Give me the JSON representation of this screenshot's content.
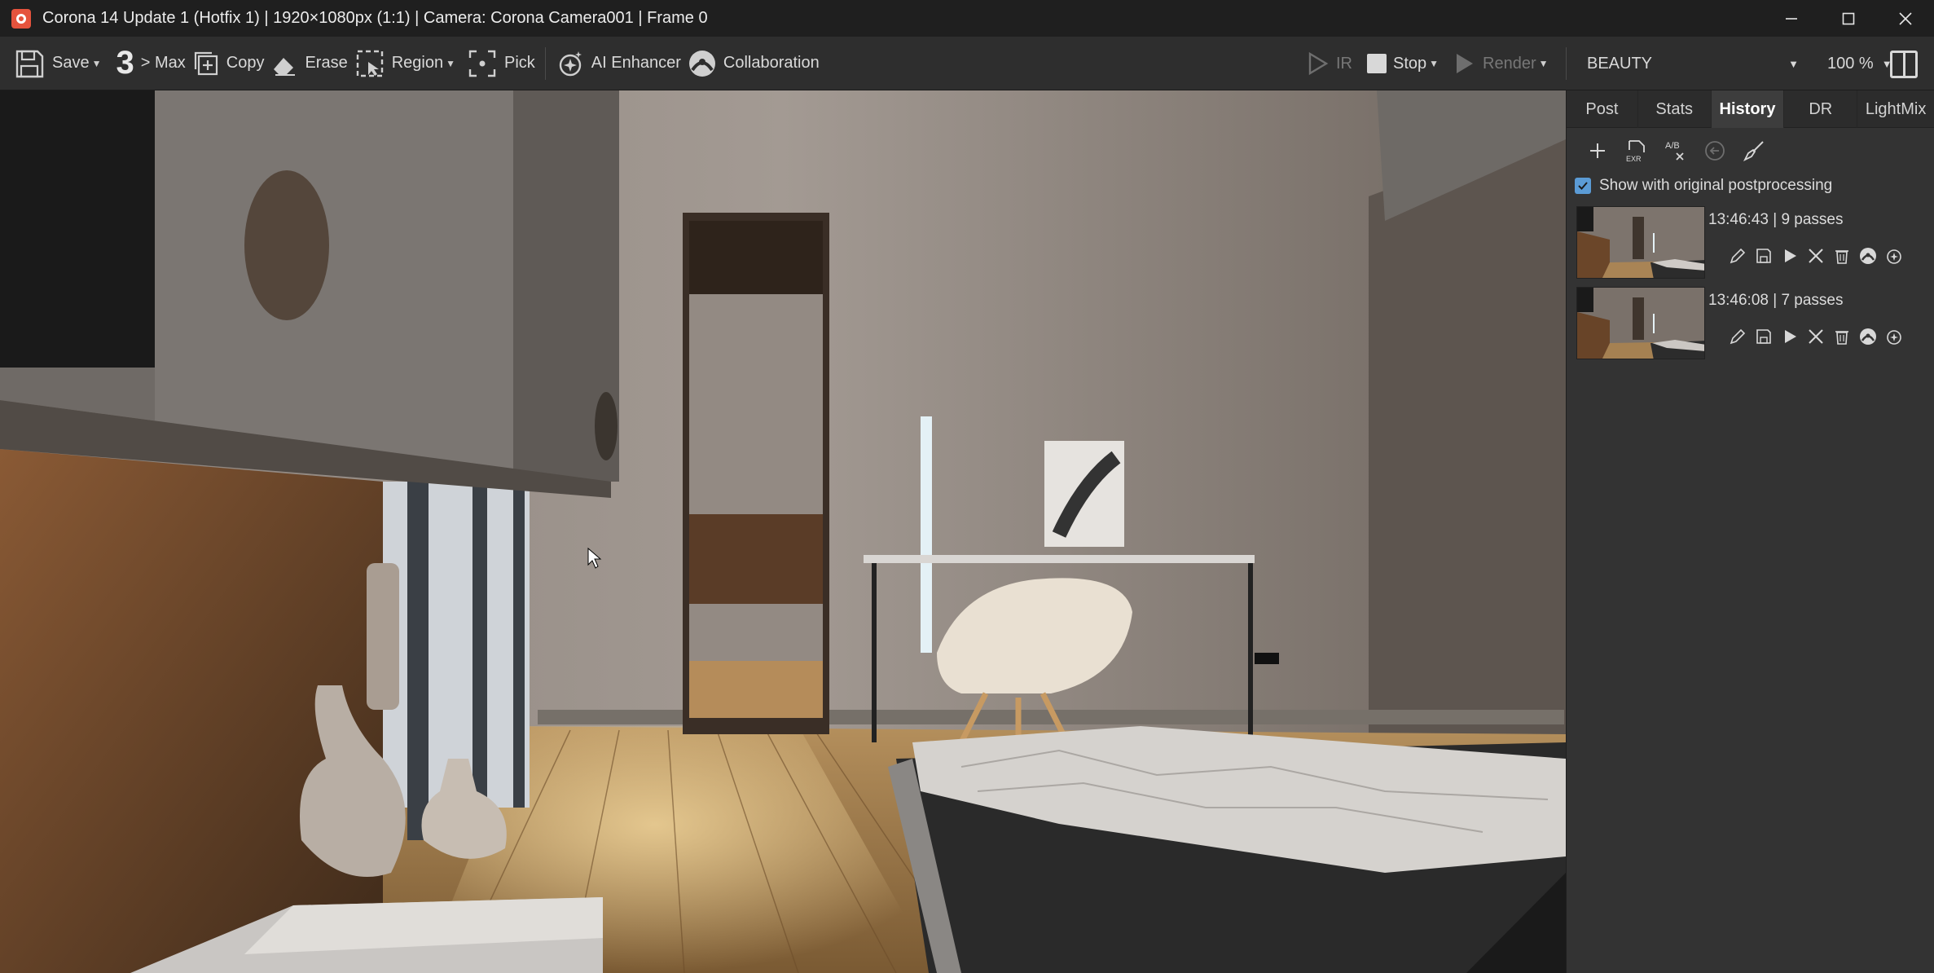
{
  "window": {
    "title": "Corona 14 Update 1 (Hotfix 1) | 1920×1080px (1:1) | Camera: Corona Camera001 | Frame 0",
    "controls": {
      "minimize": "—",
      "maximize": "☐",
      "close": "✕"
    }
  },
  "toolbar": {
    "save_label": "Save",
    "max_number": "3",
    "max_label": "> Max",
    "copy_label": "Copy",
    "erase_label": "Erase",
    "region_label": "Region",
    "pick_label": "Pick",
    "ai_enhancer_label": "AI Enhancer",
    "collaboration_label": "Collaboration",
    "ir_label": "IR",
    "stop_label": "Stop",
    "render_label": "Render",
    "channel_value": "BEAUTY",
    "zoom_value": "100 %"
  },
  "panel": {
    "tabs": [
      {
        "label": "Post",
        "active": false
      },
      {
        "label": "Stats",
        "active": false
      },
      {
        "label": "History",
        "active": true
      },
      {
        "label": "DR",
        "active": false
      },
      {
        "label": "LightMix",
        "active": false
      }
    ],
    "tools": {
      "add": "add-icon",
      "save_exr": "save-exr-icon",
      "exr_label": "EXR",
      "ab_compare": "ab-compare-icon",
      "ab_label": "A/B",
      "revert": "revert-icon",
      "clear": "clear-brush-icon"
    },
    "show_original": {
      "label": "Show with original postprocessing",
      "checked": true
    },
    "history": [
      {
        "label": "13:46:43 | 9 passes"
      },
      {
        "label": "13:46:08 | 7 passes"
      }
    ]
  },
  "colors": {
    "accent": "#5b9bd5",
    "title_bg": "#1f1f1f",
    "toolbar_bg": "#2e2e2e",
    "panel_bg": "#333333",
    "app_icon": "#e5533d"
  }
}
